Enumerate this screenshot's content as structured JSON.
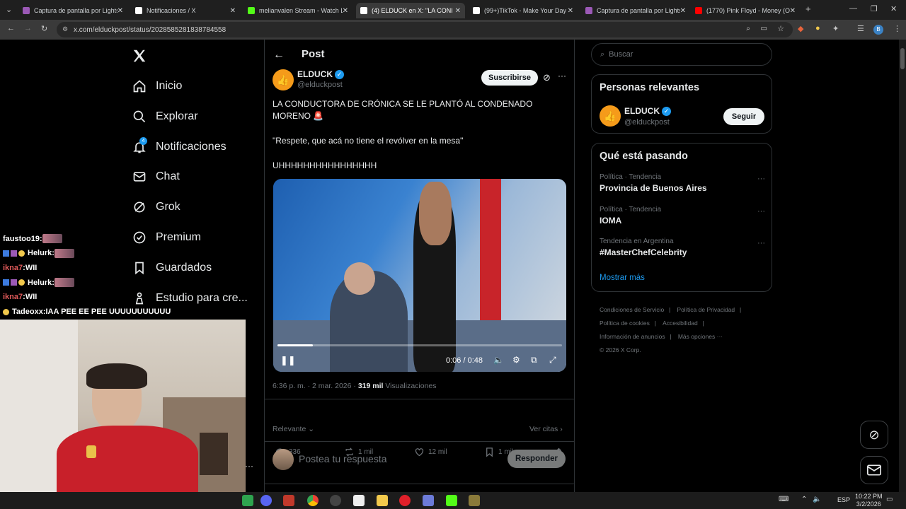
{
  "browser": {
    "tabs": [
      {
        "label": "Captura de pantalla por Lightsh",
        "favicon_color": "#9b59b6",
        "active": false
      },
      {
        "label": "Notificaciones / X",
        "favicon_color": "#ffffff",
        "active": false
      },
      {
        "label": "melianvalen Stream - Watch Li",
        "favicon_color": "#53fc18",
        "active": false
      },
      {
        "label": "(4) ELDUCK en X: \"LA CONI",
        "favicon_color": "#ffffff",
        "active": true
      },
      {
        "label": "(99+)TikTok - Make Your Day",
        "favicon_color": "#ffffff",
        "active": false
      },
      {
        "label": "Captura de pantalla por Lights",
        "favicon_color": "#9b59b6",
        "active": false
      },
      {
        "label": "(1770) Pink Floyd - Money (Offi",
        "favicon_color": "#ff0000",
        "active": false
      }
    ],
    "url": "x.com/elduckpost/status/2028585281838784558",
    "profile_initial": "B"
  },
  "nav": {
    "items": [
      {
        "label": "Inicio",
        "icon": "home-icon"
      },
      {
        "label": "Explorar",
        "icon": "search-icon"
      },
      {
        "label": "Notificaciones",
        "icon": "bell-icon",
        "badge": "4"
      },
      {
        "label": "Chat",
        "icon": "mail-icon"
      },
      {
        "label": "Grok",
        "icon": "grok-icon"
      },
      {
        "label": "Premium",
        "icon": "premium-icon"
      },
      {
        "label": "Guardados",
        "icon": "bookmark-icon"
      },
      {
        "label": "Estudio para cre...",
        "icon": "studio-icon"
      }
    ]
  },
  "stream_chat": [
    {
      "user": "faustoo19",
      "msg": "",
      "color": "#ffffff"
    },
    {
      "user": "Helurk",
      "msg": "",
      "color": "#ffffff"
    },
    {
      "user": "ikna7",
      "msg": "WII",
      "color": "#e05a5a"
    },
    {
      "user": "Helurk",
      "msg": "",
      "color": "#ffffff"
    },
    {
      "user": "ikna7",
      "msg": "WII",
      "color": "#e05a5a"
    },
    {
      "user": "Tadeoxx",
      "msg": "IAA PEE EE PEE UUUUUUUUUUU",
      "color": "#ffffff"
    }
  ],
  "post": {
    "header_title": "Post",
    "author_name": "ELDUCK",
    "author_handle": "@elduckpost",
    "subscribe_label": "Suscribirse",
    "text_line1": "LA CONDUCTORA DE CRÓNICA SE LE PLANTÓ AL CONDENADO",
    "text_line2": "MORENO 🚨",
    "text_quote": "\"Respete, que acá no tiene el revólver en la mesa\"",
    "text_shout": "UHHHHHHHHHHHHHHHH",
    "video_time": "0:06 / 0:48",
    "video_progress": 0.125,
    "timestamp": "6:36 p. m. · 2 mar. 2026 · ",
    "views_count": "319 mil",
    "views_label": " Visualizaciones",
    "replies": "336",
    "reposts": "1 mil",
    "likes": "12 mil",
    "bookmarks": "1 mil",
    "sort_label": "Relevante",
    "quotes_label": "Ver citas",
    "reply_placeholder": "Postea tu respuesta",
    "reply_button": "Responder"
  },
  "sidebar": {
    "search_placeholder": "Buscar",
    "relevant_title": "Personas relevantes",
    "relevant_name": "ELDUCK",
    "relevant_handle": "@elduckpost",
    "follow_label": "Seguir",
    "trending_title": "Qué está pasando",
    "trends": [
      {
        "category": "Política · Tendencia",
        "name": "Provincia de Buenos Aires"
      },
      {
        "category": "Política · Tendencia",
        "name": "IOMA"
      },
      {
        "category": "Tendencia en Argentina",
        "name": "#MasterChefCelebrity"
      }
    ],
    "show_more": "Mostrar más",
    "footer": {
      "terms": "Condiciones de Servicio",
      "privacy": "Política de Privacidad",
      "cookies": "Política de cookies",
      "accessibility": "Accesibilidad",
      "ads": "Información de anuncios",
      "more": "Más opciones ···",
      "copyright": "© 2026 X Corp."
    }
  },
  "taskbar": {
    "lang": "ESP",
    "time": "10:22 PM",
    "date": "3/2/2026"
  },
  "colors": {
    "accent": "#1d9bf0",
    "muted": "#71767b",
    "border": "#2f3336"
  }
}
